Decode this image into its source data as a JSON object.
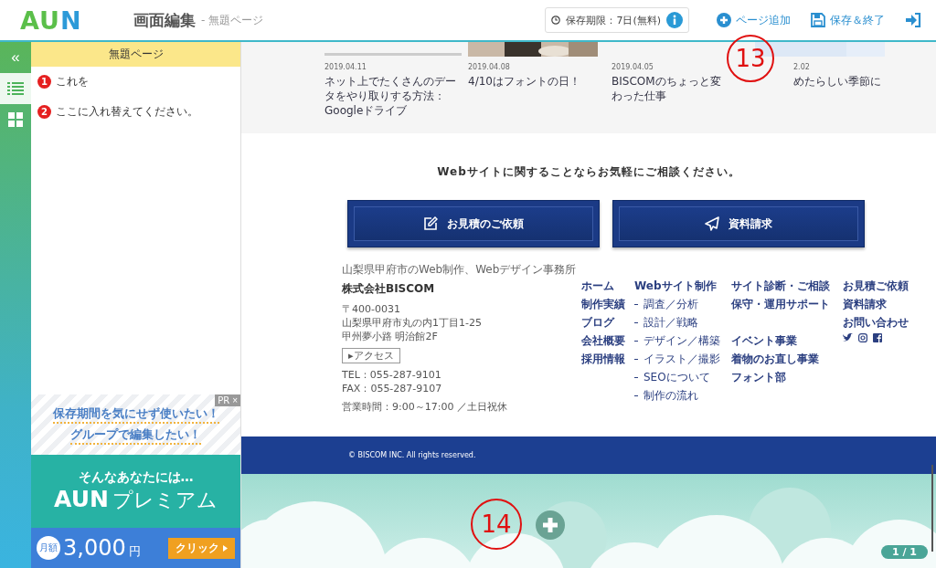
{
  "header": {
    "logo": "AUN",
    "title": "画面編集",
    "subtitle": "- 無題ページ",
    "retention": "保存期限：7日(無料)",
    "actions": [
      {
        "kind": "add",
        "label": "ページ追加"
      },
      {
        "kind": "save",
        "label": "保存＆終了"
      },
      {
        "kind": "exit"
      }
    ]
  },
  "rail": {
    "collapse": "«",
    "tools": [
      {
        "kind": "list",
        "selected": true
      },
      {
        "kind": "grid",
        "selected": false
      }
    ]
  },
  "panel": {
    "title": "無題ページ",
    "items": [
      {
        "number": "1",
        "text": "これを"
      },
      {
        "number": "2",
        "text": "ここに入れ替えてください。"
      }
    ]
  },
  "ad": {
    "tag": "PR",
    "close": "×",
    "lines": [
      "保存期間を気にせず使いたい！",
      "グループで編集したい！"
    ],
    "lead": "そんなあなたには…",
    "logo": "AUN",
    "product": "プレミアム",
    "price_label": "月額",
    "price": "3,000",
    "currency": "円",
    "cta": "クリック"
  },
  "preview": {
    "posts": [
      {
        "date": "2019.04.11",
        "title": "ネット上でたくさんのデータをやり取りする方法：Googleドライブ"
      },
      {
        "date": "2019.04.08",
        "title": "4/10はフォントの日！"
      },
      {
        "date": "2019.04.05",
        "title": "BISCOMのちょっと変わった仕事"
      },
      {
        "date": "2.02",
        "title": "めたらしい季節に"
      }
    ],
    "contact": {
      "lead": "Webサイトに関することならお気軽にご相談ください。",
      "buttons": [
        {
          "kind": "edit",
          "label": "お見積のご依頼"
        },
        {
          "kind": "send",
          "label": "資料請求"
        }
      ]
    },
    "footer": {
      "tagline": "山梨県甲府市のWeb制作、Webデザイン事務所",
      "company": "株式会社BISCOM",
      "address": [
        "〒400-0031",
        "山梨県甲府市丸の内1丁目1-25",
        "甲州夢小路 明治館2F"
      ],
      "access": "▸アクセス",
      "phones": [
        "TEL：055-287-9101",
        "FAX：055-287-9107"
      ],
      "hours": "営業時間：9:00～17:00 ／土日祝休",
      "columns": [
        [
          {
            "label": "ホーム",
            "kind": "link"
          },
          {
            "label": "制作実績",
            "kind": "link"
          },
          {
            "label": "ブログ",
            "kind": "link"
          },
          {
            "label": "会社概要",
            "kind": "link"
          },
          {
            "label": "採用情報",
            "kind": "link"
          }
        ],
        [
          {
            "label": "Webサイト制作",
            "kind": "link"
          },
          {
            "label": "調査／分析",
            "kind": "sub"
          },
          {
            "label": "設計／戦略",
            "kind": "sub"
          },
          {
            "label": "デザイン／構築",
            "kind": "sub"
          },
          {
            "label": "イラスト／撮影",
            "kind": "sub"
          },
          {
            "label": "SEOについて",
            "kind": "sub"
          },
          {
            "label": "制作の流れ",
            "kind": "sub"
          }
        ],
        [
          {
            "label": "サイト診断・ご相談",
            "kind": "link"
          },
          {
            "label": "保守・運用サポート",
            "kind": "link"
          },
          {
            "label": "イベント事業",
            "kind": "gap"
          },
          {
            "label": "着物のお直し事業",
            "kind": "link"
          },
          {
            "label": "フォント部",
            "kind": "link"
          }
        ],
        [
          {
            "label": "お見積ご依頼",
            "kind": "link"
          },
          {
            "label": "資料請求",
            "kind": "link"
          },
          {
            "label": "お問い合わせ",
            "kind": "link"
          },
          {
            "kind": "social"
          }
        ]
      ]
    },
    "copyright": "© BISCOM INC. All rights reserved."
  },
  "annotations": [
    {
      "label": "13"
    },
    {
      "label": "14"
    }
  ],
  "pager": "1 / 1"
}
